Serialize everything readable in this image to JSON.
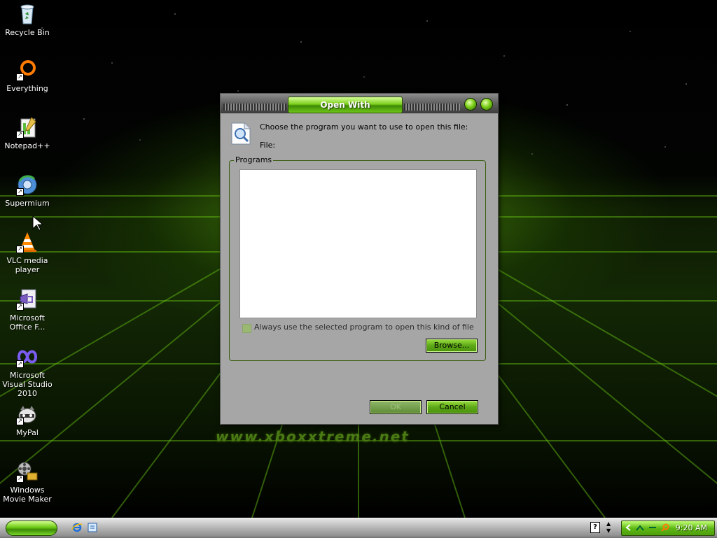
{
  "desktop": {
    "watermark": "www.xboxxtreme.net",
    "icons": [
      {
        "label": "Recycle Bin",
        "icon": "recycle-bin-icon"
      },
      {
        "label": "Everything",
        "icon": "everything-search-icon"
      },
      {
        "label": "Notepad++",
        "icon": "notepad-plus-plus-icon"
      },
      {
        "label": "Supermium",
        "icon": "supermium-browser-icon"
      },
      {
        "label": "VLC media player",
        "icon": "vlc-cone-icon"
      },
      {
        "label": "Microsoft Office F...",
        "icon": "office-document-icon"
      },
      {
        "label": "Microsoft Visual Studio 2010",
        "icon": "visual-studio-icon"
      },
      {
        "label": "MyPal",
        "icon": "mypal-raccoon-icon"
      },
      {
        "label": "Windows Movie Maker",
        "icon": "movie-maker-icon"
      }
    ]
  },
  "dialog": {
    "title": "Open With",
    "prompt": "Choose the program you want to use to open this file:",
    "file_label": "File:",
    "programs_label": "Programs",
    "always_use_label": "Always use the selected program to open this kind of file",
    "always_use_checked": false,
    "browse_label": "Browse...",
    "ok_label": "OK",
    "cancel_label": "Cancel"
  },
  "taskbar": {
    "clock": "9:20 AM",
    "help_glyph": "?",
    "accent": "#6bc713"
  }
}
